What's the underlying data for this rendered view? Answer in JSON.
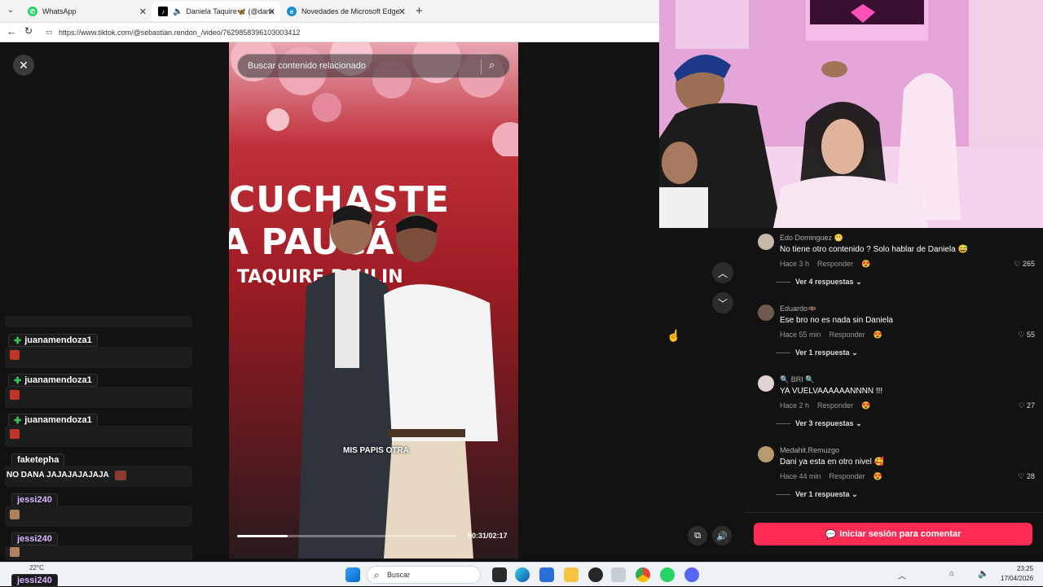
{
  "browser": {
    "tabs": [
      {
        "label": "WhatsApp",
        "active": false
      },
      {
        "label": "Daniela Taquire🦋 (@daniela",
        "active": true
      },
      {
        "label": "Novedades de Microsoft Edge",
        "active": false
      }
    ],
    "url": "https://www.tiktok.com/@sebastian.rendon_/video/7629858396103003412"
  },
  "video": {
    "search_placeholder": "Buscar contenido relacionado",
    "banner_text": [
      "CUCHASTE",
      "A PAUCÁ",
      "TAQUIRE PAULIN"
    ],
    "caption": "MIS PAPIS OTRA",
    "time": "00:31/02:17",
    "progress": 0.23
  },
  "comments": [
    {
      "user": "Edo Dominguez 😬",
      "text": "No tiene otro contenido ? Solo hablar de Daniela 😅",
      "time": "Hace 3 h",
      "reply": "Responder",
      "likes": "265",
      "replies": "Ver 4 respuestas"
    },
    {
      "user": "Eduardo🦇",
      "text": "Ese bro no es nada sin Daniela",
      "time": "Hace 55 min",
      "reply": "Responder",
      "likes": "55",
      "replies": "Ver 1 respuesta"
    },
    {
      "user": "🔍 BRI 🔍",
      "text": "YA VUELVAAAAAANNNN !!!",
      "time": "Hace 2 h",
      "reply": "Responder",
      "likes": "27",
      "replies": "Ver 3 respuestas"
    },
    {
      "user": "Medahit.Remuzgo",
      "text": "Dani ya esta en otro nivel 🥰",
      "time": "Hace 44 min",
      "reply": "Responder",
      "likes": "28",
      "replies": "Ver 1 respuesta"
    }
  ],
  "login_button": "Iniciar sesión para comentar",
  "chat": [
    {
      "name": "juanamendoza1",
      "msg": ""
    },
    {
      "name": "juanamendoza1",
      "msg": ""
    },
    {
      "name": "juanamendoza1",
      "msg": ""
    },
    {
      "name": "faketepha",
      "msg": "NO DANA JAJAJAJAJAJA"
    },
    {
      "name": "jessi240",
      "msg": ""
    },
    {
      "name": "jessi240",
      "msg": ""
    },
    {
      "name": "jessi240",
      "msg": ""
    }
  ],
  "taskbar": {
    "search": "Buscar",
    "weather": "22°C",
    "time": "23:25",
    "date": "17/04/2026"
  }
}
